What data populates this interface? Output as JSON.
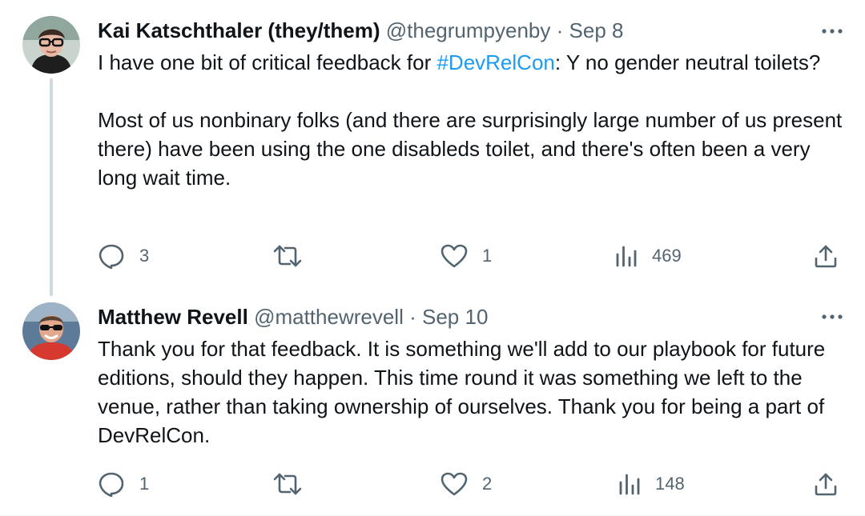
{
  "tweets": [
    {
      "author": {
        "display_name": "Kai Katschthaler (they/them)",
        "handle": "@thegrumpyenby",
        "avatar": "avatar-kai"
      },
      "dot": "·",
      "date": "Sep 8",
      "text": {
        "p1_before": "I have one bit of critical feedback for ",
        "p1_hashtag": "#DevRelCon",
        "p1_after": ": Y no gender neutral toilets?",
        "p2": "Most of us nonbinary folks (and there are surprisingly large number of us present there) have been using the one disableds toilet, and there's often been a very long wait time."
      },
      "stats": {
        "replies": "3",
        "retweets": "",
        "likes": "1",
        "views": "469"
      },
      "icons": [
        "reply-icon",
        "retweet-icon",
        "like-icon",
        "views-icon",
        "share-icon",
        "more-icon"
      ]
    },
    {
      "author": {
        "display_name": "Matthew Revell",
        "handle": "@matthewrevell",
        "avatar": "avatar-matthew"
      },
      "dot": "·",
      "date": "Sep 10",
      "text": {
        "p1": "Thank you for that feedback. It is something we'll add to our playbook for future editions, should they happen. This time round it was something we left to the venue, rather than taking ownership of ourselves. Thank you for being a part of DevRelCon."
      },
      "stats": {
        "replies": "1",
        "retweets": "",
        "likes": "2",
        "views": "148"
      },
      "icons": [
        "reply-icon",
        "retweet-icon",
        "like-icon",
        "views-icon",
        "share-icon",
        "more-icon"
      ]
    }
  ],
  "colors": {
    "text": "#0f1419",
    "secondary": "#536471",
    "link": "#1d9bf0",
    "thread_line": "#cfd9de"
  }
}
